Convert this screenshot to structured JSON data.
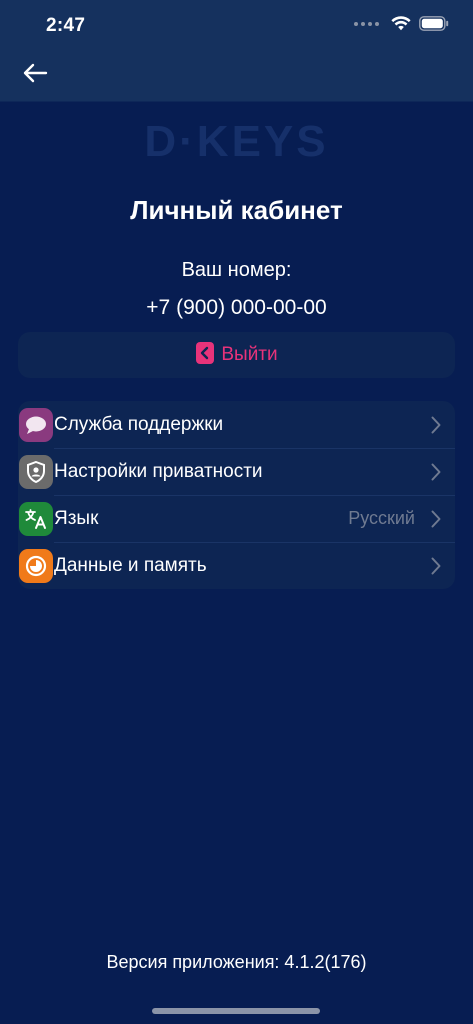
{
  "status_bar": {
    "time": "2:47"
  },
  "logo": {
    "text": "D·KEYS"
  },
  "page": {
    "title": "Личный кабинет",
    "phone_label": "Ваш номер:",
    "phone_number": "+7 (900) 000-00-00"
  },
  "logout": {
    "label": "Выйти",
    "icon": "logout-icon",
    "color": "#e8337a"
  },
  "settings": [
    {
      "label": "Служба поддержки",
      "icon": "chat-bubble-icon",
      "color": "#8a3a7f",
      "value": ""
    },
    {
      "label": "Настройки приватности",
      "icon": "shield-user-icon",
      "color": "#6b6b6b",
      "value": ""
    },
    {
      "label": "Язык",
      "icon": "translate-icon",
      "color": "#1f8a3a",
      "value": "Русский"
    },
    {
      "label": "Данные и память",
      "icon": "storage-pie-icon",
      "color": "#f07a1a",
      "value": ""
    }
  ],
  "footer": {
    "version": "Версия приложения: 4.1.2(176)"
  }
}
